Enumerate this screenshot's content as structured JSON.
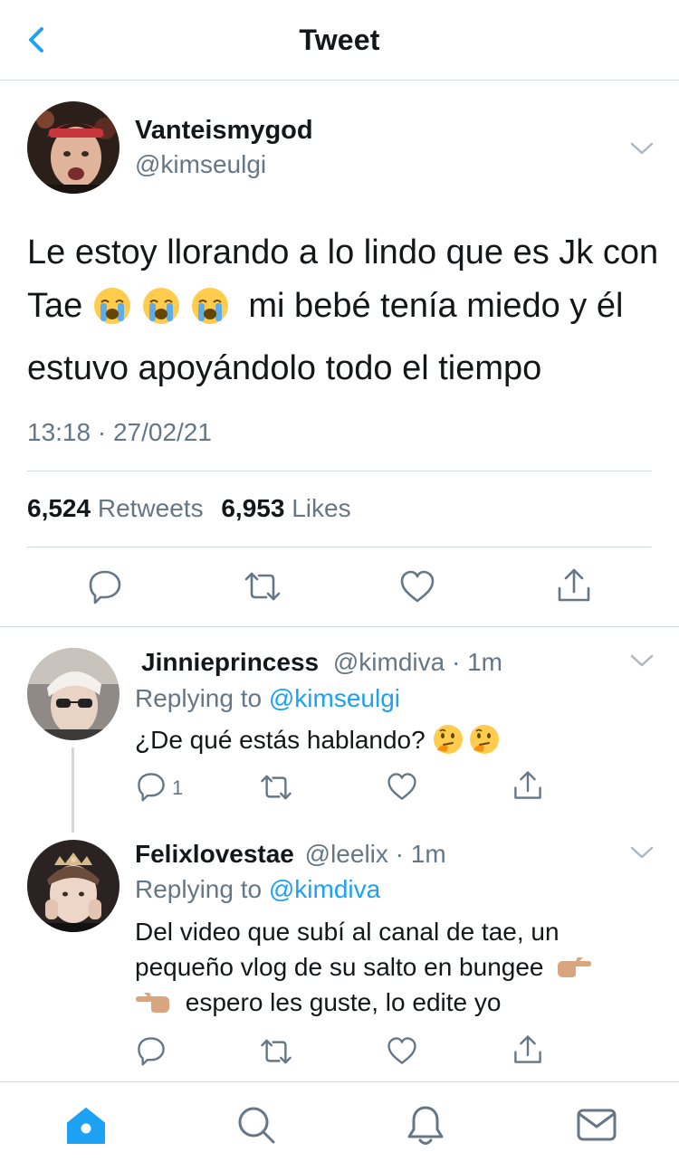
{
  "header": {
    "title": "Tweet",
    "back_icon": "back-chevron-icon"
  },
  "main_tweet": {
    "display_name": "Vanteismygod",
    "handle": "@kimseulgi",
    "text_part1": "Le estoy llorando a lo lindo que es Jk con Tae",
    "emojis": "😭😭😭",
    "text_part2": "mi bebé tenía miedo y él estuvo apoyándolo todo el tiempo",
    "timestamp": "13:18 · 27/02/21",
    "retweets_count": "6,524",
    "retweets_label": "Retweets",
    "likes_count": "6,953",
    "likes_label": "Likes"
  },
  "replies": [
    {
      "display_name": "Jinnieprincess",
      "meta": "@kimdiva · 1m",
      "replying_prefix": "Replying to",
      "replying_handle": "@kimseulgi",
      "text": "¿De qué estás hablando?",
      "emojis": "🤔🤔",
      "reply_count": "1"
    },
    {
      "display_name": "Felixlovestae",
      "meta": "@leelix · 1m",
      "replying_prefix": "Replying to",
      "replying_handle": "@kimdiva",
      "text_line1": "Del video que subí al canal de tae, un",
      "text_line2": "pequeño vlog de su salto en bungee",
      "text_line3": "espero les guste, lo edite yo",
      "emojis_right": "👉🏼",
      "emojis_left": "👈🏼"
    }
  ],
  "colors": {
    "accent": "#1da1f2",
    "secondary": "#657786",
    "icon": "#657786",
    "divider": "#d4d9de"
  },
  "tab_bar": {
    "items": [
      "home-icon",
      "search-icon",
      "notifications-icon",
      "messages-icon"
    ]
  }
}
